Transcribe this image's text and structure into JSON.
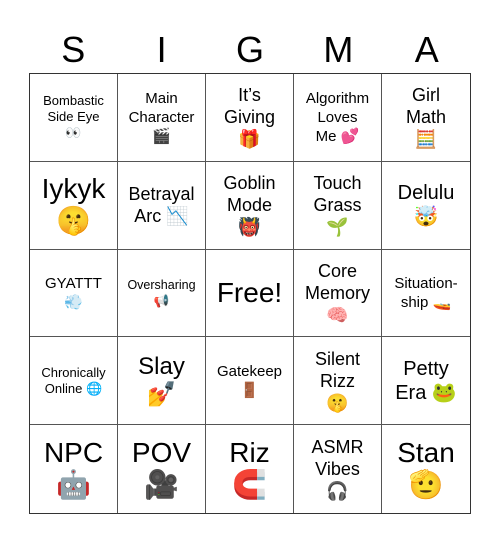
{
  "header": {
    "letters": [
      "S",
      "I",
      "G",
      "M",
      "A"
    ]
  },
  "board": {
    "cells": [
      {
        "text": "Bombastic\nSide Eye\n👀",
        "icon": "eyes-icon"
      },
      {
        "text": "Main\nCharacter\n🎬",
        "icon": "clapper-board-icon"
      },
      {
        "text": "It’s\nGiving\n🎁",
        "icon": "gift-icon"
      },
      {
        "text": "Algorithm\nLoves\nMe 💕",
        "icon": "two-hearts-icon"
      },
      {
        "text": "Girl\nMath\n🧮",
        "icon": "abacus-icon"
      },
      {
        "text": "Iykyk\n🤫",
        "icon": "shushing-face-icon"
      },
      {
        "text": "Betrayal\nArc 📉",
        "icon": "chart-decreasing-icon"
      },
      {
        "text": "Goblin\nMode\n👹",
        "icon": "ogre-icon"
      },
      {
        "text": "Touch\nGrass\n🌱",
        "icon": "seedling-icon"
      },
      {
        "text": "Delulu\n🤯",
        "icon": "exploding-head-icon"
      },
      {
        "text": "GYATTT\n💨",
        "icon": "dashing-away-icon"
      },
      {
        "text": "Oversharing\n📢",
        "icon": "loudspeaker-icon"
      },
      {
        "text": "Free!",
        "icon": ""
      },
      {
        "text": "Core\nMemory\n🧠",
        "icon": "brain-icon"
      },
      {
        "text": "Situation-\nship 🚤",
        "icon": "speedboat-icon"
      },
      {
        "text": "Chronically\nOnline 🌐",
        "icon": "globe-icon"
      },
      {
        "text": "Slay\n💅",
        "icon": "nail-polish-icon"
      },
      {
        "text": "Gatekeep\n🚪",
        "icon": "door-icon"
      },
      {
        "text": "Silent\nRizz\n🤫",
        "icon": "shushing-face-icon"
      },
      {
        "text": "Petty\nEra 🐸",
        "icon": "frog-icon"
      },
      {
        "text": "NPC\n🤖",
        "icon": "robot-icon"
      },
      {
        "text": "POV\n🎥",
        "icon": "movie-camera-icon"
      },
      {
        "text": "Riz\n🧲",
        "icon": "magnet-icon"
      },
      {
        "text": "ASMR\nVibes\n🎧",
        "icon": "headphones-icon"
      },
      {
        "text": "Stan\n🫡",
        "icon": "saluting-face-icon"
      }
    ]
  }
}
